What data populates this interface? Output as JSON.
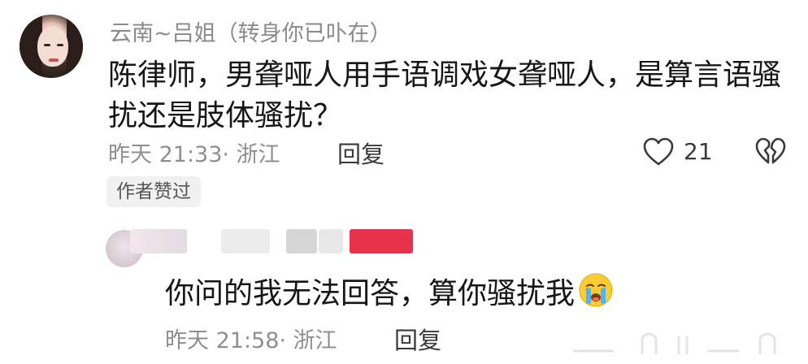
{
  "comment": {
    "username": "云南~吕姐（转身你已卟在）",
    "text": "陈律师，男聋哑人用手语调戏女聋哑人，是算言语骚扰还是肢体骚扰？",
    "meta": "昨天 21:33· 浙江",
    "reply_label": "回复",
    "like_count": "21",
    "author_badge": "作者赞过",
    "icons": {
      "like": "heart-outline-icon",
      "dislike": "broken-heart-icon"
    }
  },
  "reply": {
    "text": "你问的我无法回答，算你骚扰我",
    "emoji": "crying-face-emoji",
    "meta": "昨天 21:58· 浙江",
    "reply_label": "回复"
  },
  "colors": {
    "text_primary": "#161616",
    "text_secondary": "#8f8f8f",
    "badge_bg": "#f1f1f1",
    "accent_red": "#e8324c"
  }
}
